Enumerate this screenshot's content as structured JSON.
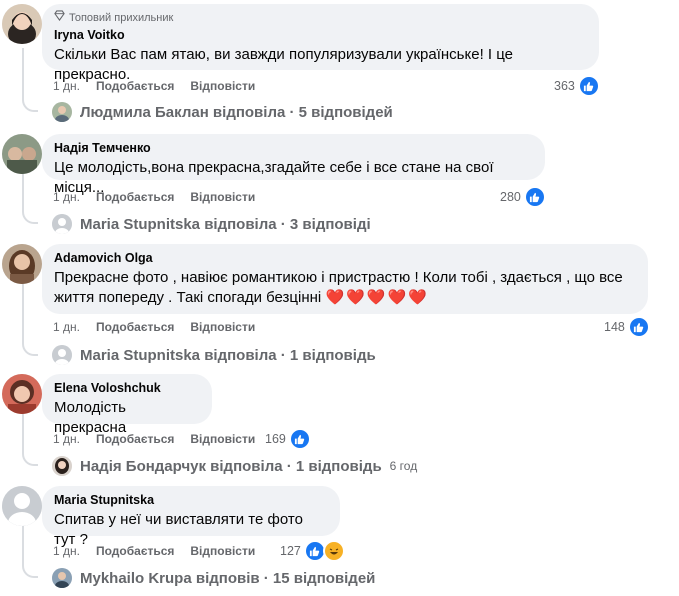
{
  "comments": [
    {
      "author": "Iryna Voitko",
      "badge": "Топовий прихильник",
      "text": "Скільки Вас пам ятаю, ви завжди популяризували українське! І це прекрасно.",
      "time": "1 дн.",
      "like": "Подобається",
      "reply": "Відповісти",
      "count": "363",
      "replies": "Людмила Баклан відповіла · 5 відповідей"
    },
    {
      "author": "Надія Темченко",
      "text": "Це молодість,вона прекрасна,згадайте себе і все стане на свої місця...",
      "time": "1 дн.",
      "like": "Подобається",
      "reply": "Відповісти",
      "count": "280",
      "replies": "Maria Stupnitska відповіла · 3 відповіді"
    },
    {
      "author": "Adamovich Olga",
      "text_line1": "Прекрасне фото , навіює романтикою і пристрастю ! Коли тобі , здається , що все",
      "text_line2": "життя попереду . Такі спогади безцінні",
      "emoji": "❤️❤️❤️❤️❤️",
      "time": "1 дн.",
      "like": "Подобається",
      "reply": "Відповісти",
      "count": "148",
      "replies": "Maria Stupnitska відповіла · 1 відповідь"
    },
    {
      "author": "Elena Voloshchuk",
      "text": "Молодість прекрасна",
      "time": "1 дн.",
      "like": "Подобається",
      "reply": "Відповісти",
      "count": "169",
      "replies": "Надія Бондарчук відповіла · 1 відповідь",
      "replies_time": "6 год"
    },
    {
      "author": "Maria Stupnitska",
      "text": "Спитав у неї чи виставляти те фото тут ?",
      "time": "1 дн.",
      "like": "Подобається",
      "reply": "Відповісти",
      "count": "127",
      "replies": "Mykhailo Krupa відповів · 15 відповідей"
    }
  ],
  "icons": {
    "like": "like-icon",
    "haha": "haha-icon",
    "badge": "top-fan-icon"
  },
  "colors": {
    "bubble": "#f0f2f5",
    "secondary_text": "#65676b",
    "like_blue": "#1877f2",
    "thread_line": "#dadde1"
  }
}
